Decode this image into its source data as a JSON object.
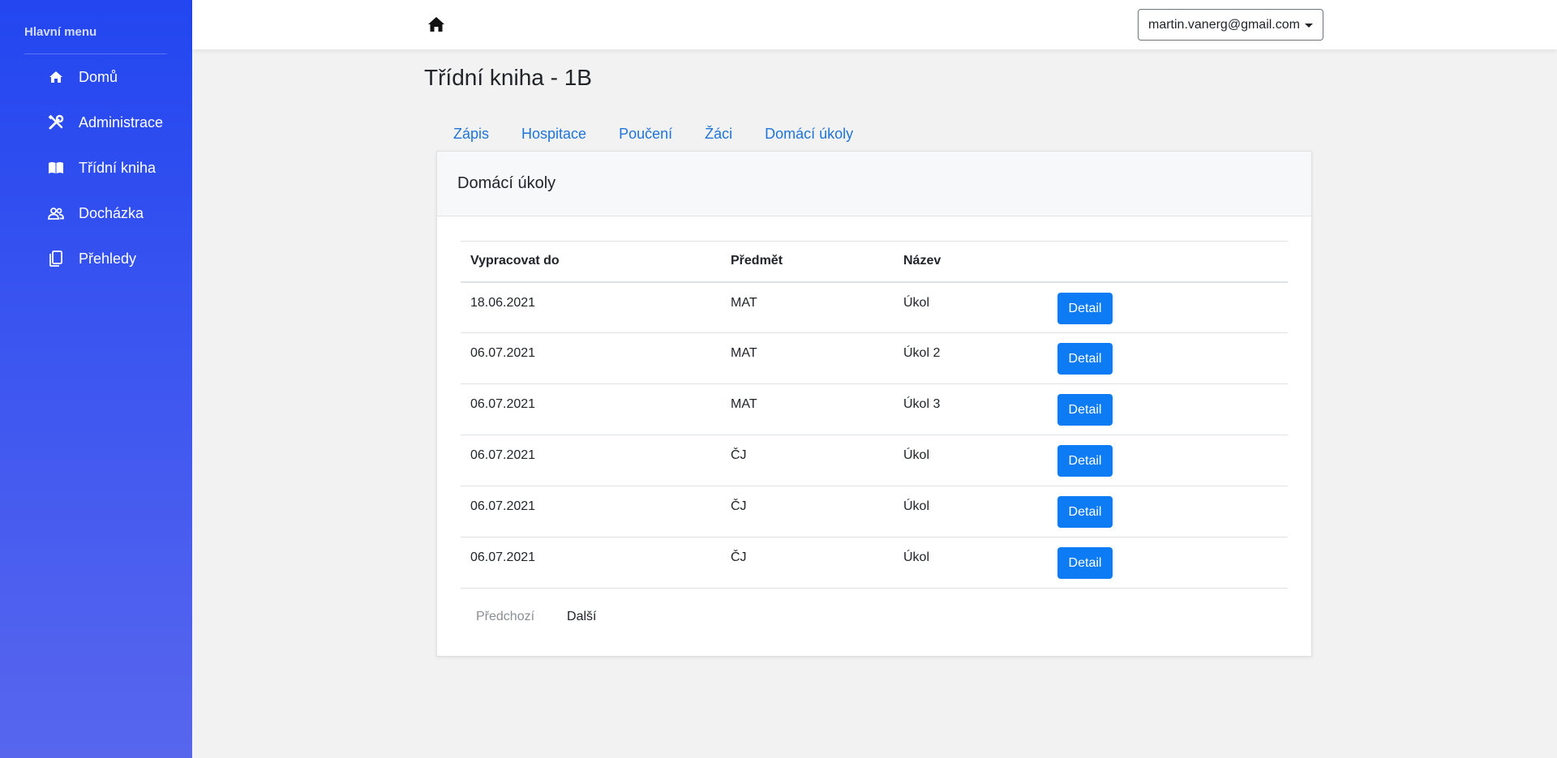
{
  "sidebar": {
    "heading": "Hlavní menu",
    "items": [
      {
        "label": "Domů",
        "icon": "home-icon"
      },
      {
        "label": "Administrace",
        "icon": "tools-icon"
      },
      {
        "label": "Třídní kniha",
        "icon": "book-icon"
      },
      {
        "label": "Docházka",
        "icon": "people-icon"
      },
      {
        "label": "Přehledy",
        "icon": "notes-icon"
      }
    ]
  },
  "topbar": {
    "home_icon": "home-icon",
    "user_email": "martin.vanerg@gmail.com"
  },
  "page": {
    "title": "Třídní kniha - 1B",
    "tabs": [
      "Zápis",
      "Hospitace",
      "Poučení",
      "Žáci",
      "Domácí úkoly"
    ]
  },
  "card": {
    "header": "Domácí úkoly",
    "columns": [
      "Vypracovat do",
      "Předmět",
      "Název"
    ],
    "rows": [
      {
        "date": "18.06.2021",
        "subject": "MAT",
        "name": "Úkol",
        "action": "Detail"
      },
      {
        "date": "06.07.2021",
        "subject": "MAT",
        "name": "Úkol 2",
        "action": "Detail"
      },
      {
        "date": "06.07.2021",
        "subject": "MAT",
        "name": "Úkol 3",
        "action": "Detail"
      },
      {
        "date": "06.07.2021",
        "subject": "ČJ",
        "name": "Úkol",
        "action": "Detail"
      },
      {
        "date": "06.07.2021",
        "subject": "ČJ",
        "name": "Úkol",
        "action": "Detail"
      },
      {
        "date": "06.07.2021",
        "subject": "ČJ",
        "name": "Úkol",
        "action": "Detail"
      }
    ],
    "pagination": {
      "prev": "Předchozí",
      "next": "Další"
    }
  },
  "colors": {
    "sidebar_top": "#2246f0",
    "sidebar_bottom": "#5866ee",
    "accent": "#0d7bf4",
    "tab_link": "#1f74d9"
  }
}
